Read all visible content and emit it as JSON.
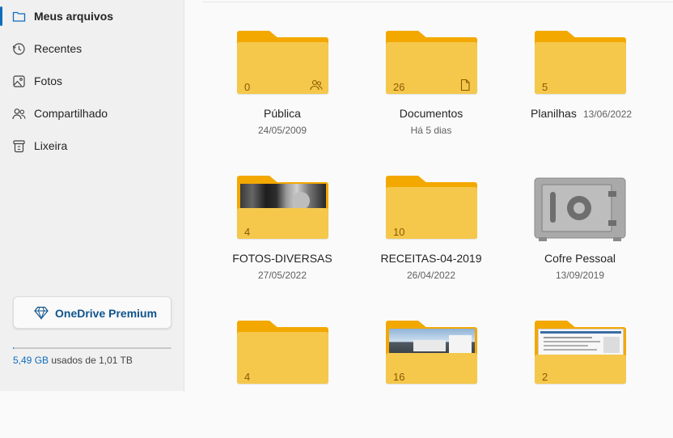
{
  "sidebar": {
    "items": [
      {
        "label": "Meus arquivos",
        "icon": "folder-icon",
        "active": true
      },
      {
        "label": "Recentes",
        "icon": "history-icon",
        "active": false
      },
      {
        "label": "Fotos",
        "icon": "image-icon",
        "active": false
      },
      {
        "label": "Compartilhado",
        "icon": "people-icon",
        "active": false
      },
      {
        "label": "Lixeira",
        "icon": "trash-icon",
        "active": false
      }
    ],
    "premium_label": "OneDrive Premium",
    "storage": {
      "used": "5,49 GB",
      "text": " usados de 1,01 TB",
      "fraction_used": 0.0053
    }
  },
  "files": [
    {
      "name": "Pública",
      "date": "24/05/2009",
      "count": "0",
      "badge": "people-icon"
    },
    {
      "name": "Documentos",
      "date": "Há 5 dias",
      "count": "26",
      "badge": "document-icon"
    },
    {
      "name": "Planilhas",
      "date": "13/06/2022",
      "count": "5"
    },
    {
      "name": "FOTOS-DIVERSAS",
      "date": "27/05/2022",
      "count": "4"
    },
    {
      "name": "RECEITAS-04-2019",
      "date": "26/04/2022",
      "count": "10"
    },
    {
      "name": "Cofre Pessoal",
      "date": "13/09/2019",
      "icon": "vault-icon"
    },
    {
      "count": "4"
    },
    {
      "count": "16"
    },
    {
      "count": "2"
    }
  ],
  "colors": {
    "accent": "#0f6cbd",
    "folder_back": "#f3a800",
    "folder_front": "#f5c84c"
  }
}
